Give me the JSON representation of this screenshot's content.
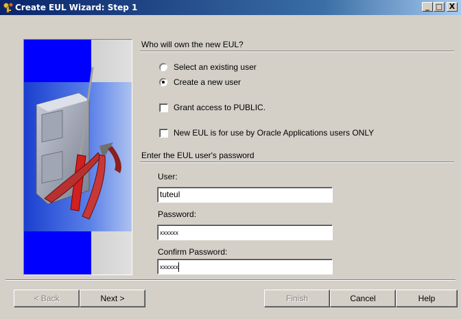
{
  "window": {
    "title": "Create EUL Wizard: Step 1",
    "minimize_glyph": "_",
    "maximize_glyph": "□",
    "close_glyph": "X"
  },
  "ownership": {
    "question": "Who will own the new EUL?",
    "options": [
      {
        "label": "Select an existing user",
        "selected": false
      },
      {
        "label": "Create a new user",
        "selected": true
      }
    ]
  },
  "checkboxes": {
    "grant_public": {
      "label": "Grant access to PUBLIC.",
      "checked": false
    },
    "oracle_apps": {
      "label": "New EUL is for use by Oracle Applications users ONLY",
      "checked": false
    }
  },
  "password_section": {
    "heading": "Enter the EUL user's password",
    "user_label": "User:",
    "user_value": "tuteul",
    "password_label": "Password:",
    "password_value": "xxxxxx",
    "confirm_label": "Confirm Password:",
    "confirm_value": "xxxxxx"
  },
  "buttons": {
    "back": "< Back",
    "next": "Next >",
    "finish": "Finish",
    "cancel": "Cancel",
    "help": "Help"
  },
  "icons": [
    "wizard-key-icon",
    "file-cabinet-icon",
    "screwdriver-icon",
    "pliers-icon"
  ],
  "colors": {
    "title_bar_start": "#0a246a",
    "title_bar_end": "#a6caf0",
    "panel_blue": "#0000ff",
    "dialog_gray": "#d4d0c8"
  }
}
